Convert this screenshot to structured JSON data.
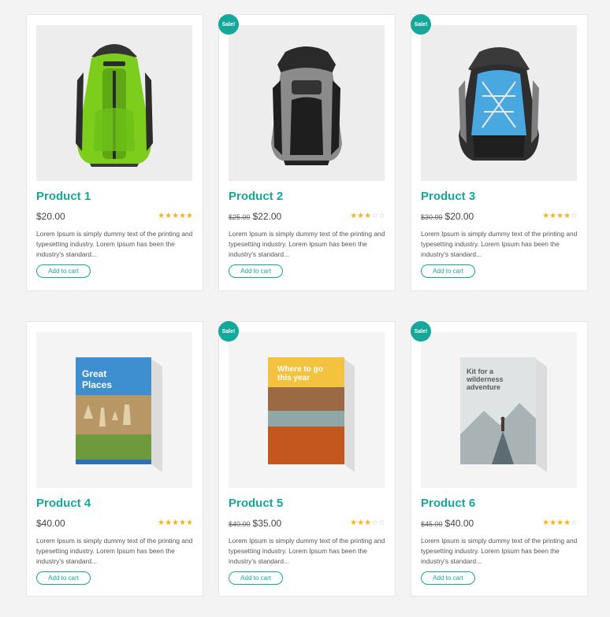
{
  "sale_badge": "Sale!",
  "products": [
    {
      "title": "Product 1",
      "old_price": "",
      "price": "$20.00",
      "rating": 5,
      "stars": "★★★★★",
      "desc": "Lorem Ipsum is simply dummy text of the printing and typesetting industry. Lorem Ipsum has been the industry's standard...",
      "button": "Add to cart",
      "image": "green-backpack-image",
      "sale": false
    },
    {
      "title": "Product 2",
      "old_price": "$25.00",
      "price": "$22.00",
      "rating": 3,
      "stars": "★★★☆☆",
      "desc": "Lorem Ipsum is simply dummy text of the printing and typesetting industry. Lorem Ipsum has been the industry's standard...",
      "button": "Add to cart",
      "image": "gray-backpack-image",
      "sale": true
    },
    {
      "title": "Product 3",
      "old_price": "$30.00",
      "price": "$20.00",
      "rating": 4,
      "stars": "★★★★☆",
      "desc": "Lorem Ipsum is simply dummy text of the printing and typesetting industry. Lorem Ipsum has been the industry's standard...",
      "button": "Add to cart",
      "image": "blue-backpack-image",
      "sale": true
    },
    {
      "title": "Product 4",
      "old_price": "",
      "price": "$40.00",
      "rating": 5,
      "stars": "★★★★★",
      "desc": "Lorem Ipsum is simply dummy text of the printing and typesetting industry. Lorem Ipsum has been the industry's standard...",
      "button": "Add to cart",
      "image": "great-places-book-image",
      "sale": false,
      "book_title": "Great Places"
    },
    {
      "title": "Product 5",
      "old_price": "$40.00",
      "price": "$35.00",
      "rating": 3,
      "stars": "★★★☆☆",
      "desc": "Lorem Ipsum is simply dummy text of the printing and typesetting industry. Lorem Ipsum has been the industry's standard...",
      "button": "Add to cart",
      "image": "where-to-go-book-image",
      "sale": true,
      "book_title": "Where to go this year"
    },
    {
      "title": "Product 6",
      "old_price": "$45.00",
      "price": "$40.00",
      "rating": 4,
      "stars": "★★★★☆",
      "desc": "Lorem Ipsum is simply dummy text of the printing and typesetting industry. Lorem Ipsum has been the industry's standard...",
      "button": "Add to cart",
      "image": "wilderness-book-image",
      "sale": true,
      "book_title": "Kit for a wilderness adventure"
    }
  ]
}
